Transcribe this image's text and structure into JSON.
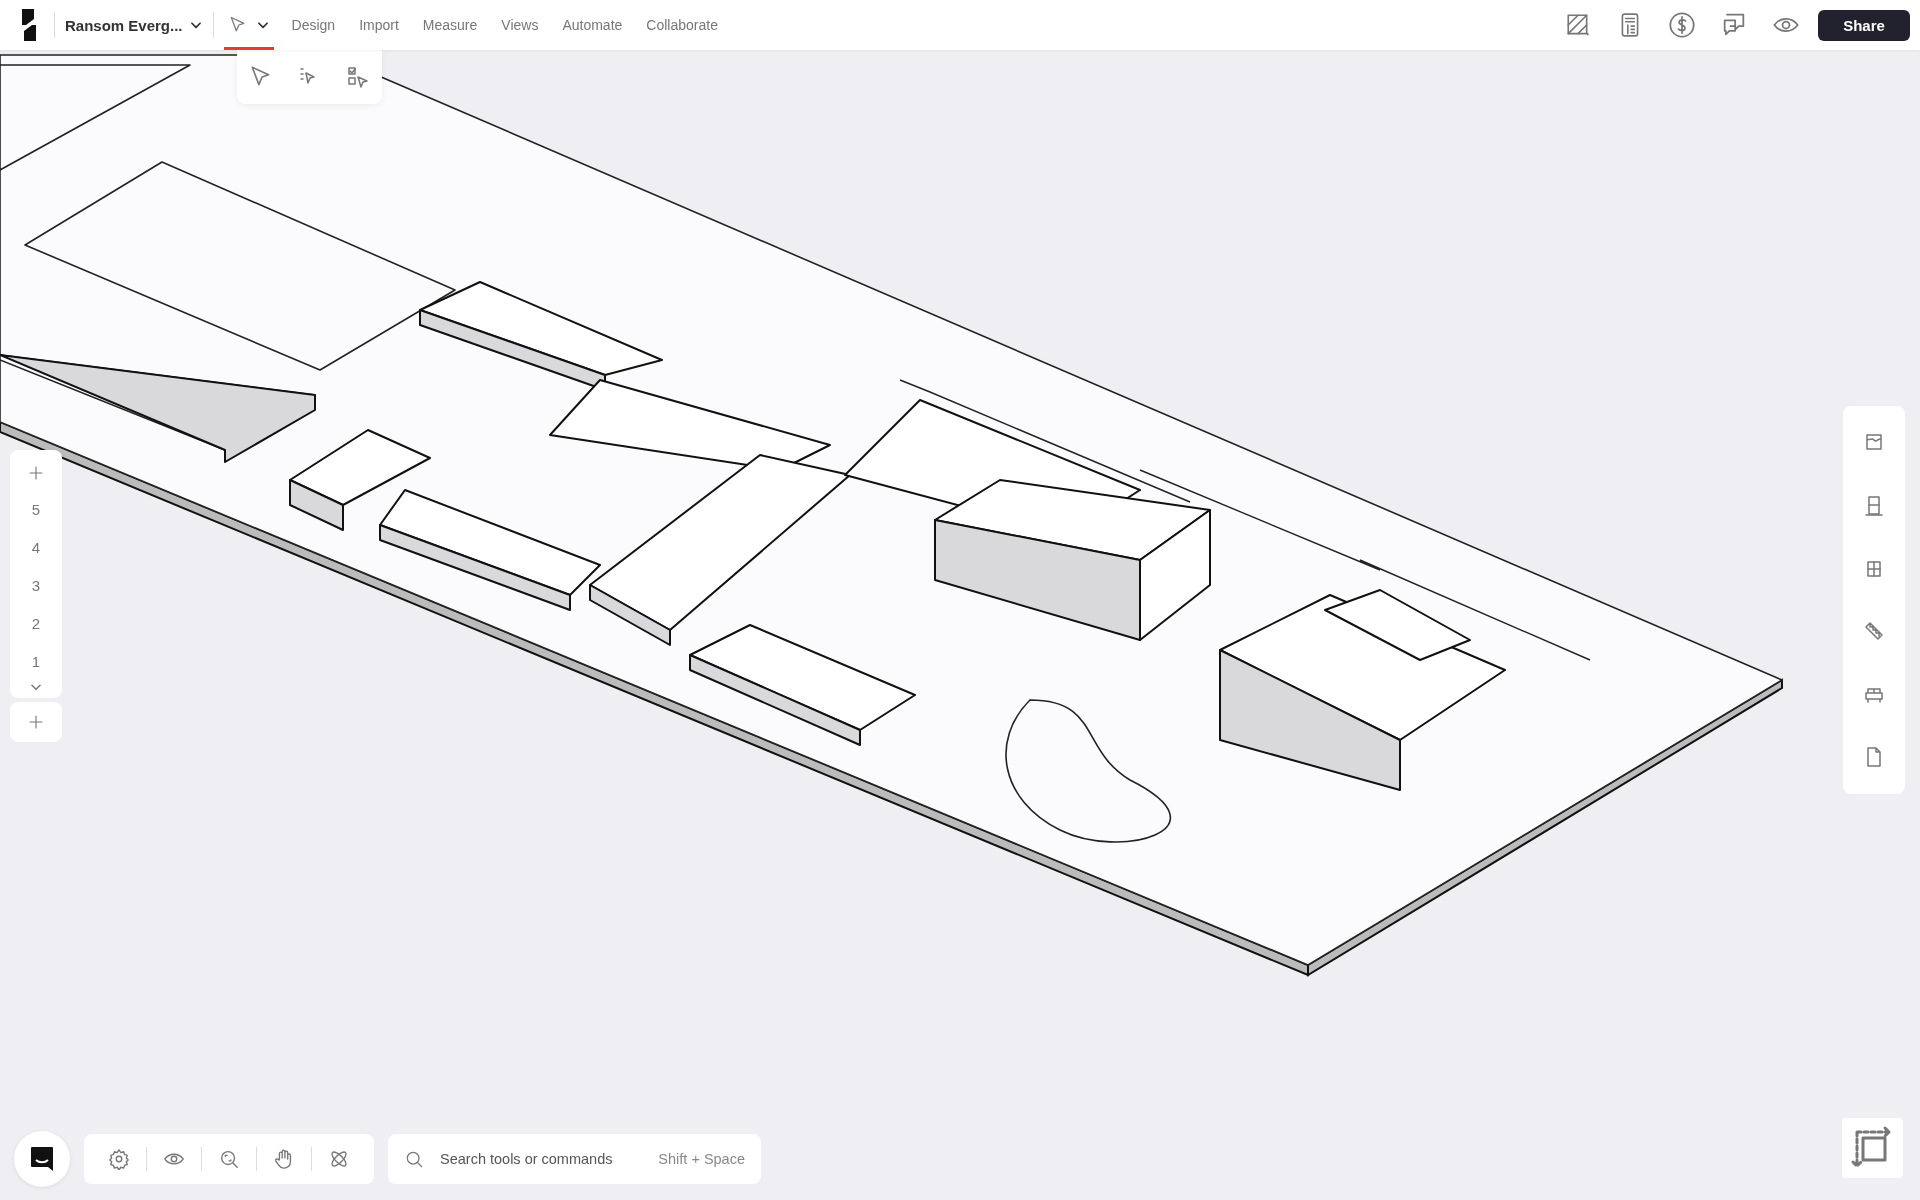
{
  "project": {
    "name": "Ransom Everg..."
  },
  "select_tool": {
    "active": true
  },
  "menu": [
    "Design",
    "Import",
    "Measure",
    "Views",
    "Automate",
    "Collaborate"
  ],
  "share_button": "Share",
  "levels": {
    "items": [
      "5",
      "4",
      "3",
      "2",
      "1"
    ]
  },
  "search": {
    "placeholder": "Search tools or commands",
    "shortcut": "Shift + Space"
  },
  "selection_menu": [
    {
      "kind": "pointer"
    },
    {
      "kind": "ordered"
    },
    {
      "kind": "multi"
    }
  ]
}
